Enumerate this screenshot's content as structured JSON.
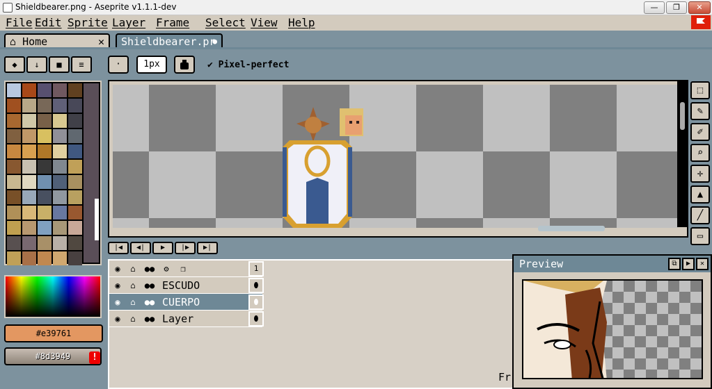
{
  "window": {
    "title": "Shieldbearer.png - Aseprite v1.1.1-dev",
    "minimize": "—",
    "maximize": "❐",
    "close": "✕"
  },
  "menu": [
    "File",
    "Edit",
    "Sprite",
    "Layer",
    "Frame",
    "Select",
    "View",
    "Help"
  ],
  "tabs": {
    "home": {
      "icon": "⌂",
      "label": "Home",
      "close": "✕"
    },
    "doc": {
      "label": "Shieldbearer.pr",
      "modified_dot": "●"
    }
  },
  "left_tools": {
    "eraser": "◆",
    "down": "↓",
    "folder": "■",
    "menu": "≡"
  },
  "context_bar": {
    "brush_type": "·",
    "brush_size": "1px",
    "pixel_perfect_check": "✔",
    "pixel_perfect": "Pixel-perfect"
  },
  "palette": [
    "#b8c8e0",
    "#a84818",
    "#585070",
    "#705860",
    "#604020",
    "#a05020",
    "#b8a888",
    "#786858",
    "#606078",
    "#484858",
    "#a86830",
    "#d0c8a8",
    "#786048",
    "#d8c890",
    "#404048",
    "#806040",
    "#c09868",
    "#d8c060",
    "#909098",
    "#606870",
    "#c88840",
    "#d8a050",
    "#b07828",
    "#e0d0a0",
    "#405880",
    "#885830",
    "#c8c0b0",
    "#383838",
    "#808890",
    "#c0a058",
    "#c8b890",
    "#e0d8c0",
    "#7090b0",
    "#506078",
    "#a89060",
    "#785028",
    "#98a8b8",
    "#485060",
    "#9098a0",
    "#b8a060",
    "#b09058",
    "#d8b878",
    "#c8b068",
    "#6878a0",
    "#985830",
    "#c0a050",
    "#b89870",
    "#80a0c0",
    "#a89878",
    "#c8a898",
    "#585050",
    "#786870",
    "#a89068",
    "#b8b0a8",
    "#504840",
    "#c0a058",
    "#a87048",
    "#c08850",
    "#d0a870",
    "#484040"
  ],
  "colors": {
    "fg": "#e39761",
    "bg": "#8d3949",
    "fg_label": "#e39761",
    "bg_label": "#8d3949",
    "warn": "!"
  },
  "right_tools": [
    {
      "name": "marquee-icon",
      "glyph": "⬚"
    },
    {
      "name": "pencil-icon",
      "glyph": "✎"
    },
    {
      "name": "eyedropper-icon",
      "glyph": "✐"
    },
    {
      "name": "zoom-icon",
      "glyph": "⌕"
    },
    {
      "name": "move-icon",
      "glyph": "✛"
    },
    {
      "name": "fill-icon",
      "glyph": "▲"
    },
    {
      "name": "line-icon",
      "glyph": "╱"
    },
    {
      "name": "rect-icon",
      "glyph": "▭"
    }
  ],
  "playback": {
    "first": "|◀",
    "prev": "◀|",
    "play": "▶",
    "next": "|▶",
    "last": "▶|"
  },
  "timeline": {
    "header": {
      "eye": "◉",
      "lock": "⌂",
      "cont": "●●",
      "gear": "⚙",
      "onion": "❐",
      "frame": "1"
    },
    "layers": [
      {
        "name": "ESCUDO",
        "eye": "◉",
        "lock": "⌂",
        "cont": "●●",
        "selected": false
      },
      {
        "name": "CUERPO",
        "eye": "◉",
        "lock": "⌂",
        "cont": "●●",
        "selected": true
      },
      {
        "name": "Layer",
        "eye": "◉",
        "lock": "⌂",
        "cont": "●●",
        "selected": false
      }
    ],
    "cel_glyph": "⬮",
    "frame_label": "Fr"
  },
  "preview": {
    "title": "Preview",
    "btn_a": "⧉",
    "btn_b": "▶",
    "btn_c": "✕"
  }
}
